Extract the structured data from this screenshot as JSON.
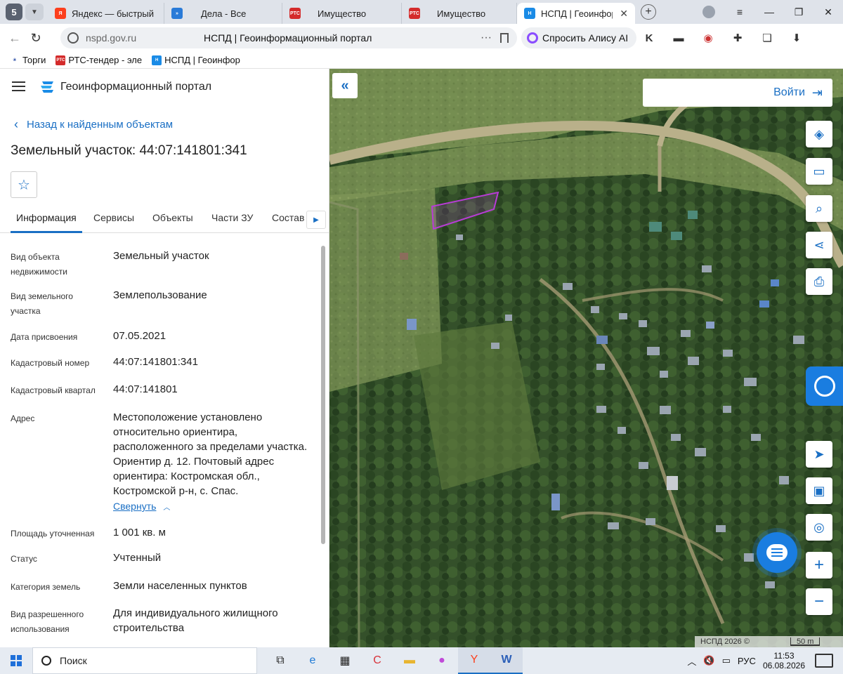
{
  "browser": {
    "tab_count": "5",
    "tabs": [
      {
        "label": "Яндекс — быстрый пои",
        "fav_color": "#fc3f1d",
        "fav_text": "Я"
      },
      {
        "label": "Дела - Все",
        "fav_color": "#2a7bd8",
        "fav_text": "»"
      },
      {
        "label": "Имущество",
        "fav_color": "#d42b2b",
        "fav_text": "РТС"
      },
      {
        "label": "Имущество",
        "fav_color": "#d42b2b",
        "fav_text": "РТС"
      },
      {
        "label": "НСПД | Геоинформ",
        "fav_color": "#1a8be6",
        "fav_text": "Н"
      }
    ],
    "url_domain": "nspd.gov.ru",
    "page_title": "НСПД | Геоинформационный портал",
    "alisa_label": "Спросить Алису AI",
    "bookmarks": [
      {
        "label": "Торги",
        "color": "#3355aa",
        "icon": "Т"
      },
      {
        "label": "РТС-тендер - эле",
        "color": "#d42b2b",
        "icon": "РТС"
      },
      {
        "label": "НСПД | Геоинфор",
        "color": "#1a8be6",
        "icon": "Н"
      }
    ]
  },
  "portal": {
    "title": "Геоинформационный портал",
    "back_label": "Назад к найденным объектам",
    "object_title": "Земельный участок: 44:07:141801:341",
    "tabs": [
      "Информация",
      "Сервисы",
      "Объекты",
      "Части ЗУ",
      "Состав"
    ],
    "properties": [
      {
        "label": "Вид объекта недвижимости",
        "value": "Земельный участок"
      },
      {
        "label": "Вид земельного участка",
        "value": "Землепользование"
      },
      {
        "label": "Дата присвоения",
        "value": "07.05.2021"
      },
      {
        "label": "Кадастровый номер",
        "value": "44:07:141801:341"
      },
      {
        "label": "Кадастровый квартал",
        "value": "44:07:141801"
      },
      {
        "label": "Адрес",
        "value": "Местоположение установлено относительно ориентира, расположенного за пределами участка. Ориентир д. 12. Почтовый адрес ориентира: Костромская обл., Костромской р-н, с. Спас."
      },
      {
        "label": "Площадь уточненная",
        "value": "1 001 кв. м"
      },
      {
        "label": "Статус",
        "value": "Учтенный"
      },
      {
        "label": "Категория земель",
        "value": "Земли населенных пунктов"
      },
      {
        "label": "Вид разрешенного использования",
        "value": "Для индивидуального жилищного строительства"
      }
    ],
    "collapse_label": "Свернуть"
  },
  "map": {
    "login_label": "Войти",
    "attribution": "НСПД 2026 ©",
    "scale_label": "50 m",
    "parcel_color": "#b83cd6",
    "controls": [
      "layers-icon",
      "ruler-icon",
      "zoom-area-icon",
      "share-icon",
      "print-icon",
      "locate-icon",
      "minimap-icon",
      "search-location-icon",
      "zoom-in-icon",
      "zoom-out-icon"
    ]
  },
  "taskbar": {
    "search_label": "Поиск",
    "lang": "РУС",
    "time": "11:53",
    "date": "06.08.2026"
  }
}
